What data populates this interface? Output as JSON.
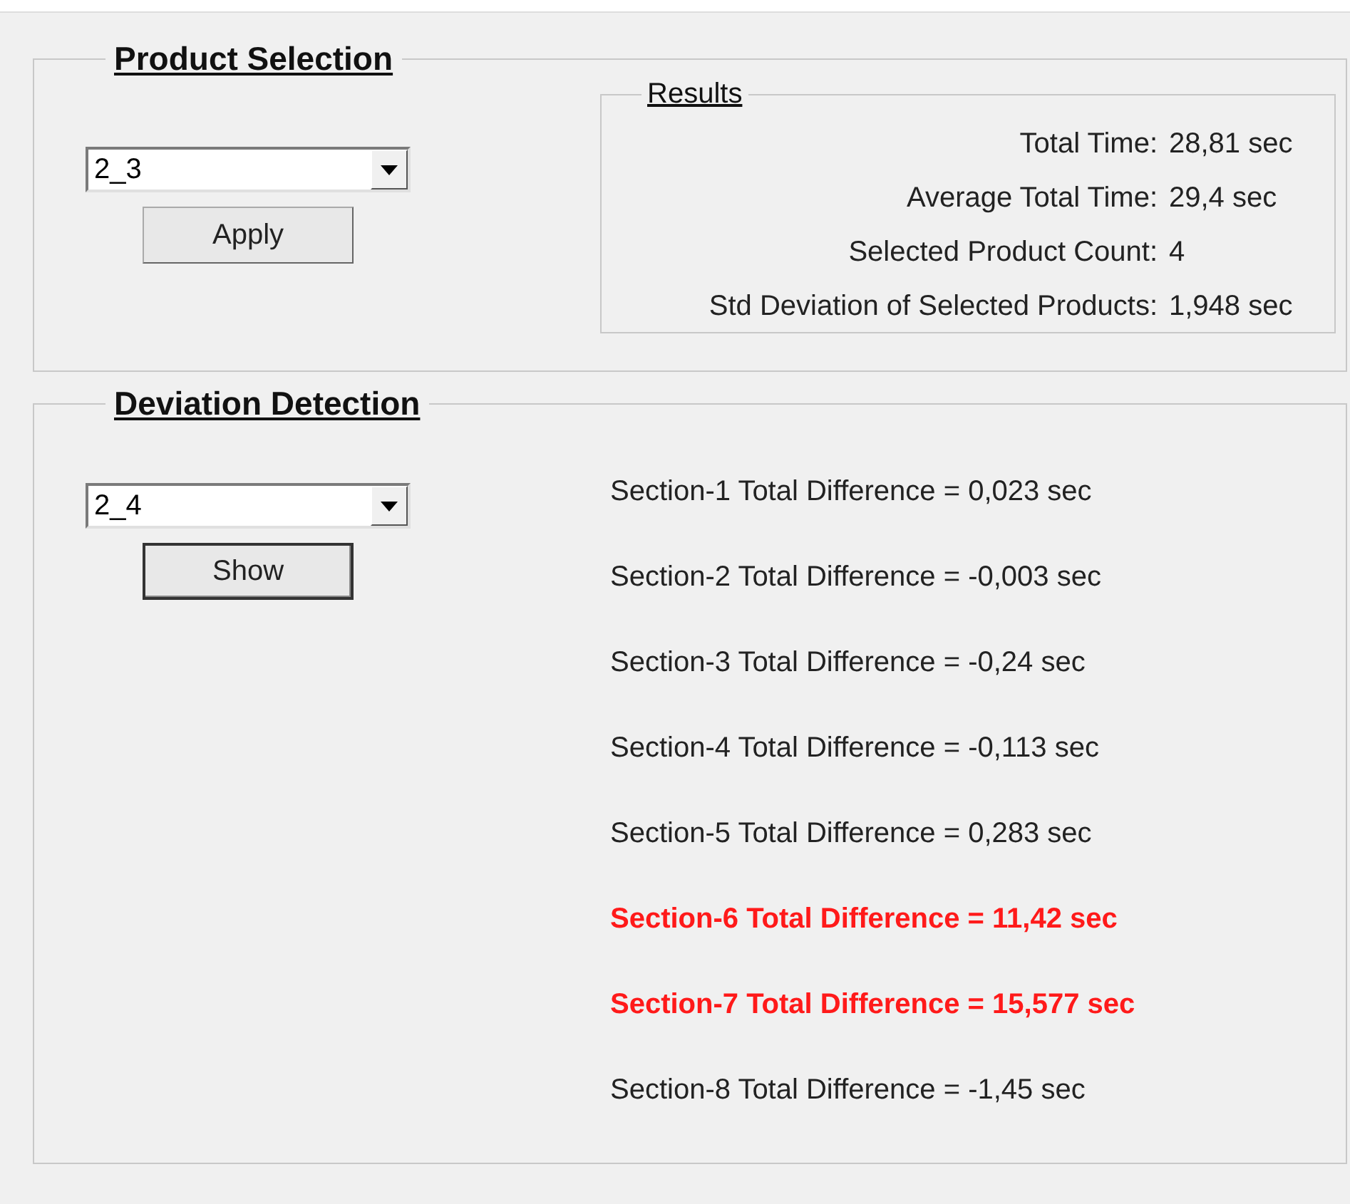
{
  "product_selection": {
    "title": "Product Selection",
    "dropdown": {
      "value": "2_3"
    },
    "button": {
      "label": "Apply",
      "focused": false
    },
    "results": {
      "title": "Results",
      "rows": [
        {
          "label": "Total Time:",
          "value": "28,81 sec"
        },
        {
          "label": "Average Total Time:",
          "value": "29,4 sec"
        },
        {
          "label": "Selected Product Count:",
          "value": "4"
        },
        {
          "label": "Std Deviation of Selected Products:",
          "value": "1,948 sec"
        }
      ]
    }
  },
  "deviation_detection": {
    "title": "Deviation Detection",
    "dropdown": {
      "value": "2_4"
    },
    "button": {
      "label": "Show",
      "focused": true
    },
    "sections": [
      {
        "text": "Section-1 Total Difference = 0,023 sec",
        "flagged": false
      },
      {
        "text": "Section-2 Total Difference = -0,003 sec",
        "flagged": false
      },
      {
        "text": "Section-3 Total Difference = -0,24 sec",
        "flagged": false
      },
      {
        "text": "Section-4 Total Difference = -0,113 sec",
        "flagged": false
      },
      {
        "text": "Section-5 Total Difference = 0,283 sec",
        "flagged": false
      },
      {
        "text": "Section-6 Total Difference = 11,42 sec",
        "flagged": true
      },
      {
        "text": "Section-7 Total Difference = 15,577 sec",
        "flagged": true
      },
      {
        "text": "Section-8 Total Difference = -1,45 sec",
        "flagged": false
      }
    ]
  }
}
